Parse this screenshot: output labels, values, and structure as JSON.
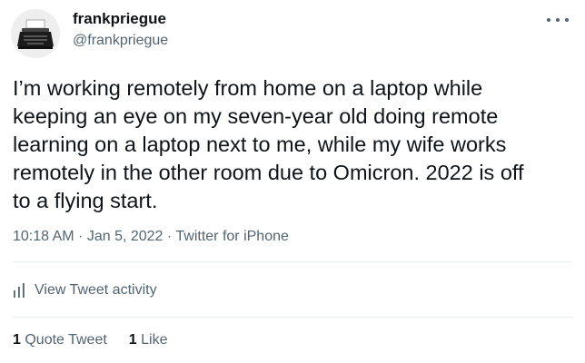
{
  "author": {
    "display_name": "frankpriegue",
    "handle": "@frankpriegue"
  },
  "tweet": {
    "lines": [
      "I’m working remotely from home on a laptop while",
      "keeping an eye on my seven-year old doing remote",
      "learning on a laptop next to me, while my wife works",
      "remotely in the other room due to Omicron.  2022 is off",
      "to a flying start."
    ],
    "time": "10:18 AM",
    "date": "Jan 5, 2022",
    "source": "Twitter for iPhone",
    "separator": " · "
  },
  "activity": {
    "label": "View Tweet activity",
    "icon": "bar-chart-icon"
  },
  "stats": {
    "quote_count": "1",
    "quote_label": "Quote Tweet",
    "like_count": "1",
    "like_label": "Like"
  },
  "colors": {
    "text_primary": "#0f1419",
    "text_secondary": "#536471",
    "divider": "#e6ecf0"
  }
}
